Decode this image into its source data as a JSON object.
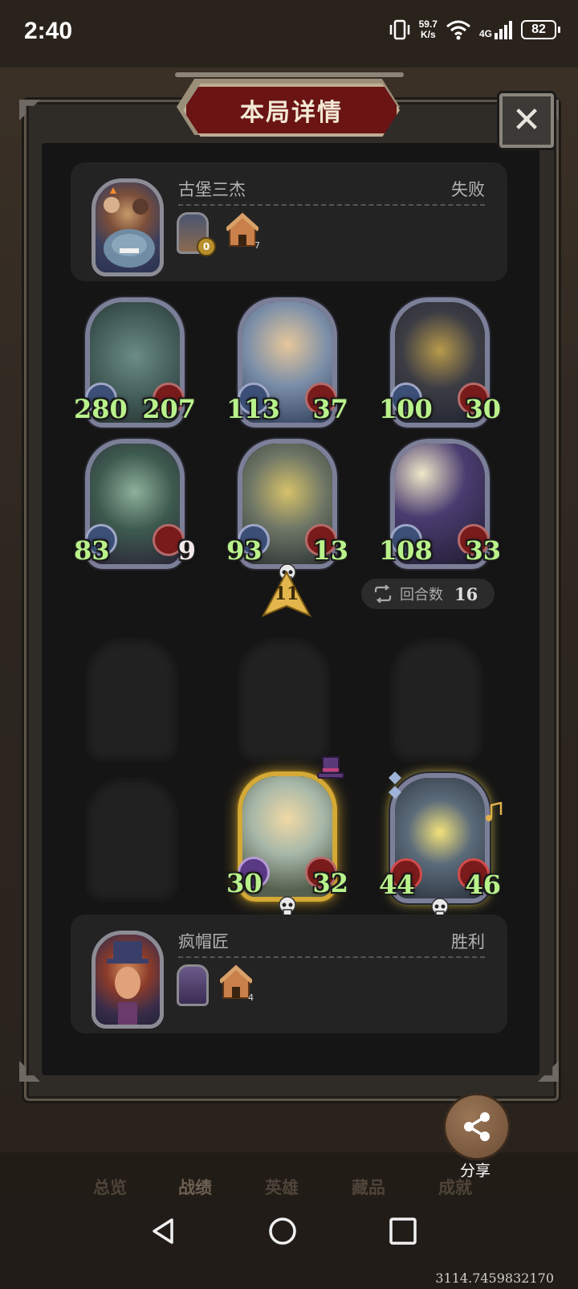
{
  "status_bar": {
    "time": "2:40",
    "net_speed_value": "59.7",
    "net_speed_unit": "K/s",
    "network_type": "4G",
    "battery": "82"
  },
  "dialog": {
    "title": "本局详情",
    "close_label": "✕"
  },
  "opponent": {
    "name": "古堡三杰",
    "result": "失败",
    "hero_badge": "0",
    "tavern_tier": "7"
  },
  "player": {
    "name": "疯帽匠",
    "result": "胜利",
    "tavern_tier": "4"
  },
  "opponent_minions": [
    {
      "attack": "280",
      "health": "207"
    },
    {
      "attack": "113",
      "health": "37"
    },
    {
      "attack": "100",
      "health": "30"
    },
    {
      "attack": "83",
      "health": "9"
    },
    {
      "attack": "93",
      "health": "13"
    },
    {
      "attack": "108",
      "health": "33"
    }
  ],
  "player_minions": [
    {
      "attack": "30",
      "health": "32"
    },
    {
      "attack": "44",
      "health": "46"
    }
  ],
  "damage_badge": "11",
  "round": {
    "label": "回合数",
    "value": "16"
  },
  "share": {
    "label": "分享"
  },
  "tabs": [
    {
      "label": "总览"
    },
    {
      "label": "战绩"
    },
    {
      "label": "英雄"
    },
    {
      "label": "藏品"
    },
    {
      "label": "成就"
    }
  ],
  "coords_text": "3114.7459832170",
  "colors": {
    "stat_green": "#b9f28b",
    "title_red": "#6a1414",
    "panel_bg": "#232323",
    "card_border": "#7c7f98",
    "golden": "#d4a936"
  }
}
